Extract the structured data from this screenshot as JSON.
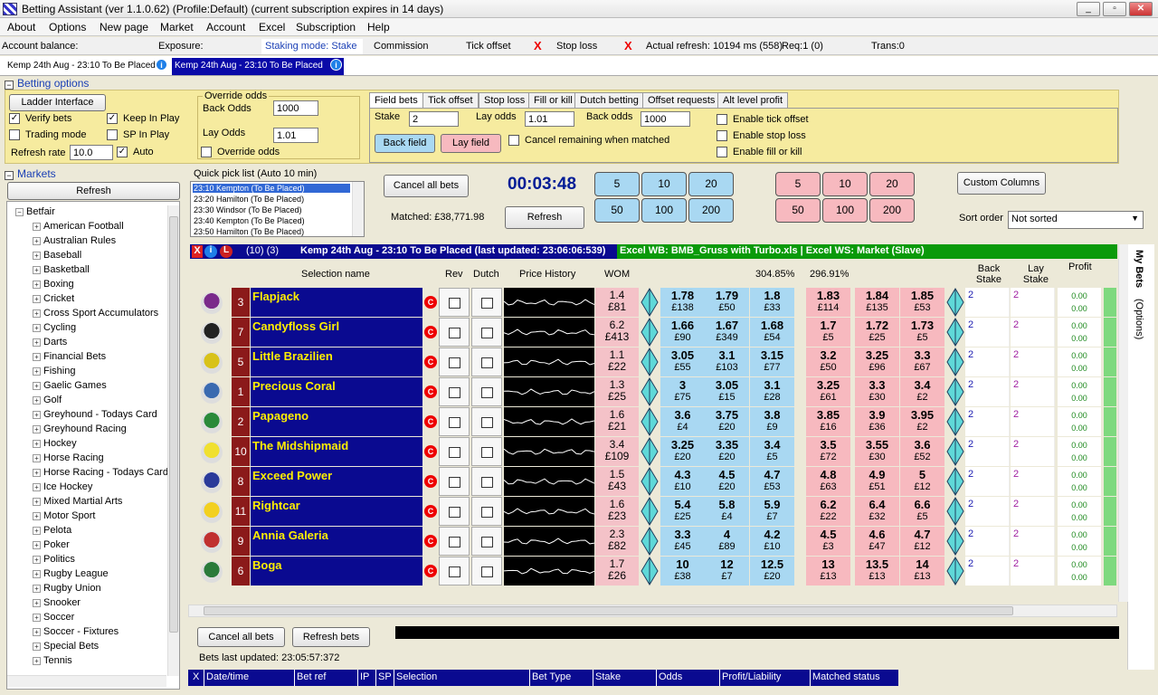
{
  "window": {
    "title": "Betting Assistant (ver 1.1.0.62)     (Profile:Default)     (current subscription expires in 14 days)"
  },
  "menu": [
    "About",
    "Options",
    "New page",
    "Market",
    "Account",
    "Excel",
    "Subscription",
    "Help"
  ],
  "status": {
    "account_balance": "Account balance:",
    "exposure": "Exposure:",
    "staking_mode": "Staking mode: Stake",
    "commission": "Commission",
    "tick_offset": "Tick offset",
    "stop_loss": "Stop loss",
    "x": "X",
    "actual_refresh": "Actual refresh: 10194 ms (558)",
    "req": "Req:1 (0)",
    "trans": "Trans:0"
  },
  "market_tabs": [
    {
      "label": "Kemp 24th Aug - 23:10 To Be Placed",
      "active": false
    },
    {
      "label": "Kemp 24th Aug - 23:10 To Be Placed",
      "active": true
    }
  ],
  "info_icon": "i",
  "betting_options": {
    "header": "Betting options",
    "ladder_btn": "Ladder Interface",
    "verify_bets": "Verify bets",
    "keep_in_play": "Keep In Play",
    "trading_mode": "Trading mode",
    "sp_in_play": "SP In Play",
    "refresh_rate_label": "Refresh rate",
    "refresh_rate": "10.0",
    "auto": "Auto",
    "override_odds_group": "Override odds",
    "back_odds_label": "Back Odds",
    "back_odds": "1000",
    "lay_odds_label": "Lay Odds",
    "lay_odds": "1.01",
    "override_odds_chk": "Override odds",
    "check_mark": "✓"
  },
  "field_tabs": [
    "Field bets",
    "Tick offset",
    "Stop loss",
    "Fill or kill",
    "Dutch betting",
    "Offset requests",
    "Alt level profit"
  ],
  "field_bets": {
    "stake_label": "Stake",
    "stake": "2",
    "lay_odds_label": "Lay odds",
    "lay_odds": "1.01",
    "back_odds_label": "Back odds",
    "back_odds": "1000",
    "back_field": "Back field",
    "lay_field": "Lay field",
    "cancel_remaining": "Cancel remaining when matched",
    "enable_tick_offset": "Enable tick offset",
    "enable_stop_loss": "Enable stop loss",
    "enable_fill_or_kill": "Enable fill or kill"
  },
  "markets": {
    "header": "Markets",
    "refresh_btn": "Refresh",
    "root": "Betfair",
    "items": [
      "American Football",
      "Australian Rules",
      "Baseball",
      "Basketball",
      "Boxing",
      "Cricket",
      "Cross Sport Accumulators",
      "Cycling",
      "Darts",
      "Financial Bets",
      "Fishing",
      "Gaelic Games",
      "Golf",
      "Greyhound - Todays Card",
      "Greyhound Racing",
      "Hockey",
      "Horse Racing",
      "Horse Racing - Todays Card",
      "Ice Hockey",
      "Mixed Martial Arts",
      "Motor Sport",
      "Pelota",
      "Poker",
      "Politics",
      "Rugby League",
      "Rugby Union",
      "Snooker",
      "Soccer",
      "Soccer - Fixtures",
      "Special Bets",
      "Tennis"
    ]
  },
  "quick_pick": {
    "label": "Quick pick list (Auto 10 min)",
    "items": [
      "23:10 Kempton (To Be Placed)",
      "23:20 Hamilton (To Be Placed)",
      "23:30 Windsor (To Be Placed)",
      "23:40 Kempton (To Be Placed)",
      "23:50 Hamilton (To Be Placed)"
    ]
  },
  "controls": {
    "cancel_all_bets": "Cancel all bets",
    "matched": "Matched: £38,771.98",
    "timer": "00:03:48",
    "refresh": "Refresh",
    "custom_columns": "Custom Columns",
    "sort_order_label": "Sort order",
    "sort_order": "Not sorted",
    "dropdown_arrow": "▼"
  },
  "back_stakes": [
    "5",
    "10",
    "20",
    "50",
    "100",
    "200"
  ],
  "lay_stakes": [
    "5",
    "10",
    "20",
    "50",
    "100",
    "200"
  ],
  "market_bar": {
    "icons": [
      "X",
      "i",
      "L"
    ],
    "counts": "(10) (3)",
    "title": "Kemp 24th Aug - 23:10 To Be Placed (last updated: 23:06:06:539)",
    "excel": "Excel WB: BMB_Gruss with Turbo.xls | Excel WS: Market (Slave)"
  },
  "grid_headers": {
    "selection_name": "Selection name",
    "rev": "Rev",
    "dutch": "Dutch",
    "price_history": "Price History",
    "wom": "WOM",
    "back_book": "304.85%",
    "lay_book": "296.91%",
    "back_stake": "Back Stake",
    "lay_stake": "Lay Stake",
    "profit": "Profit"
  },
  "right_tabs": {
    "my_bets": "My Bets",
    "options": "(Options)"
  },
  "runners": [
    {
      "num": "3",
      "name": "Flapjack",
      "wom": [
        "1.4",
        "£81"
      ],
      "back": [
        [
          "1.78",
          "£138"
        ],
        [
          "1.79",
          "£50"
        ],
        [
          "1.8",
          "£33"
        ]
      ],
      "lay": [
        [
          "1.83",
          "£114"
        ],
        [
          "1.84",
          "£135"
        ],
        [
          "1.85",
          "£53"
        ]
      ],
      "bs": "2",
      "ls": "2",
      "profit": [
        "0.00",
        "0.00"
      ],
      "silk": "#7a2a8a"
    },
    {
      "num": "7",
      "name": "Candyfloss Girl",
      "wom": [
        "6.2",
        "£413"
      ],
      "back": [
        [
          "1.66",
          "£90"
        ],
        [
          "1.67",
          "£349"
        ],
        [
          "1.68",
          "£54"
        ]
      ],
      "lay": [
        [
          "1.7",
          "£5"
        ],
        [
          "1.72",
          "£25"
        ],
        [
          "1.73",
          "£5"
        ]
      ],
      "bs": "2",
      "ls": "2",
      "profit": [
        "0.00",
        "0.00"
      ],
      "silk": "#222222"
    },
    {
      "num": "5",
      "name": "Little Brazilien",
      "wom": [
        "1.1",
        "£22"
      ],
      "back": [
        [
          "3.05",
          "£55"
        ],
        [
          "3.1",
          "£103"
        ],
        [
          "3.15",
          "£77"
        ]
      ],
      "lay": [
        [
          "3.2",
          "£50"
        ],
        [
          "3.25",
          "£96"
        ],
        [
          "3.3",
          "£67"
        ]
      ],
      "bs": "2",
      "ls": "2",
      "profit": [
        "0.00",
        "0.00"
      ],
      "silk": "#d8c21a"
    },
    {
      "num": "1",
      "name": "Precious Coral",
      "wom": [
        "1.3",
        "£25"
      ],
      "back": [
        [
          "3",
          "£75"
        ],
        [
          "3.05",
          "£15"
        ],
        [
          "3.1",
          "£28"
        ]
      ],
      "lay": [
        [
          "3.25",
          "£61"
        ],
        [
          "3.3",
          "£30"
        ],
        [
          "3.4",
          "£2"
        ]
      ],
      "bs": "2",
      "ls": "2",
      "profit": [
        "0.00",
        "0.00"
      ],
      "silk": "#3a6ab0"
    },
    {
      "num": "2",
      "name": "Papageno",
      "wom": [
        "1.6",
        "£21"
      ],
      "back": [
        [
          "3.6",
          "£4"
        ],
        [
          "3.75",
          "£20"
        ],
        [
          "3.8",
          "£9"
        ]
      ],
      "lay": [
        [
          "3.85",
          "£16"
        ],
        [
          "3.9",
          "£36"
        ],
        [
          "3.95",
          "£2"
        ]
      ],
      "bs": "2",
      "ls": "2",
      "profit": [
        "0.00",
        "0.00"
      ],
      "silk": "#2a8a3a"
    },
    {
      "num": "10",
      "name": "The Midshipmaid",
      "wom": [
        "3.4",
        "£109"
      ],
      "back": [
        [
          "3.25",
          "£20"
        ],
        [
          "3.35",
          "£20"
        ],
        [
          "3.4",
          "£5"
        ]
      ],
      "lay": [
        [
          "3.5",
          "£72"
        ],
        [
          "3.55",
          "£30"
        ],
        [
          "3.6",
          "£52"
        ]
      ],
      "bs": "2",
      "ls": "2",
      "profit": [
        "0.00",
        "0.00"
      ],
      "silk": "#f0e030"
    },
    {
      "num": "8",
      "name": "Exceed Power",
      "wom": [
        "1.5",
        "£43"
      ],
      "back": [
        [
          "4.3",
          "£10"
        ],
        [
          "4.5",
          "£20"
        ],
        [
          "4.7",
          "£53"
        ]
      ],
      "lay": [
        [
          "4.8",
          "£63"
        ],
        [
          "4.9",
          "£51"
        ],
        [
          "5",
          "£12"
        ]
      ],
      "bs": "2",
      "ls": "2",
      "profit": [
        "0.00",
        "0.00"
      ],
      "silk": "#2a3a9a"
    },
    {
      "num": "11",
      "name": "Rightcar",
      "wom": [
        "1.6",
        "£23"
      ],
      "back": [
        [
          "5.4",
          "£25"
        ],
        [
          "5.8",
          "£4"
        ],
        [
          "5.9",
          "£7"
        ]
      ],
      "lay": [
        [
          "6.2",
          "£22"
        ],
        [
          "6.4",
          "£32"
        ],
        [
          "6.6",
          "£5"
        ]
      ],
      "bs": "2",
      "ls": "2",
      "profit": [
        "0.00",
        "0.00"
      ],
      "silk": "#f2d020"
    },
    {
      "num": "9",
      "name": "Annia Galeria",
      "wom": [
        "2.3",
        "£82"
      ],
      "back": [
        [
          "3.3",
          "£45"
        ],
        [
          "4",
          "£89"
        ],
        [
          "4.2",
          "£10"
        ]
      ],
      "lay": [
        [
          "4.5",
          "£3"
        ],
        [
          "4.6",
          "£47"
        ],
        [
          "4.7",
          "£12"
        ]
      ],
      "bs": "2",
      "ls": "2",
      "profit": [
        "0.00",
        "0.00"
      ],
      "silk": "#c03030"
    },
    {
      "num": "6",
      "name": "Boga",
      "wom": [
        "1.7",
        "£26"
      ],
      "back": [
        [
          "10",
          "£38"
        ],
        [
          "12",
          "£7"
        ],
        [
          "12.5",
          "£20"
        ]
      ],
      "lay": [
        [
          "13",
          "£13"
        ],
        [
          "13.5",
          "£13"
        ],
        [
          "14",
          "£13"
        ]
      ],
      "bs": "2",
      "ls": "2",
      "profit": [
        "0.00",
        "0.00"
      ],
      "silk": "#2a7a3a"
    }
  ],
  "bets_panel": {
    "cancel_all_bets": "Cancel all bets",
    "refresh_bets": "Refresh bets",
    "last_updated": "Bets last updated: 23:05:57:372",
    "columns": [
      "X",
      "Date/time",
      "Bet ref",
      "IP",
      "SP",
      "Selection",
      "Bet Type",
      "Stake",
      "Odds",
      "Profit/Liability",
      "Matched status"
    ]
  },
  "colors": {
    "selection_bg": "#0a0a90",
    "back": "#a9d8f2",
    "lay": "#f7b9bf",
    "options_bg": "#f6eb9f"
  }
}
